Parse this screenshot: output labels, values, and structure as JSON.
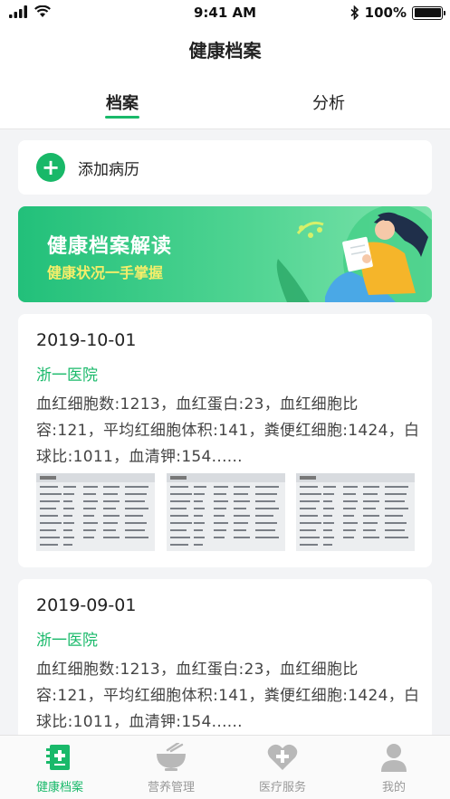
{
  "status_bar": {
    "time": "9:41 AM",
    "battery": "100%"
  },
  "header": {
    "title": "健康档案"
  },
  "tabs": [
    {
      "label": "档案",
      "active": true
    },
    {
      "label": "分析",
      "active": false
    }
  ],
  "add_record": {
    "label": "添加病历"
  },
  "banner": {
    "title": "健康档案解读",
    "subtitle": "健康状况一手掌握"
  },
  "records": [
    {
      "date": "2019-10-01",
      "hospital": "浙一医院",
      "summary": "血红细胞数:1213，血红蛋白:23，血红细胞比容:121，平均红细胞体积:141，粪便红细胞:1424，白球比:1011，血清钾:154......",
      "image_count": 3
    },
    {
      "date": "2019-09-01",
      "hospital": "浙一医院",
      "summary": "血红细胞数:1213，血红蛋白:23，血红细胞比容:121，平均红细胞体积:141，粪便红细胞:1424，白球比:1011，血清钾:154......"
    }
  ],
  "bottom_nav": [
    {
      "label": "健康档案",
      "icon": "health-record-icon",
      "active": true
    },
    {
      "label": "营养管理",
      "icon": "bowl-icon",
      "active": false
    },
    {
      "label": "医疗服务",
      "icon": "heart-plus-icon",
      "active": false
    },
    {
      "label": "我的",
      "icon": "person-icon",
      "active": false
    }
  ],
  "colors": {
    "accent": "#19b96a",
    "background": "#f3f4f6",
    "banner_subtitle": "#f5ee6a"
  }
}
